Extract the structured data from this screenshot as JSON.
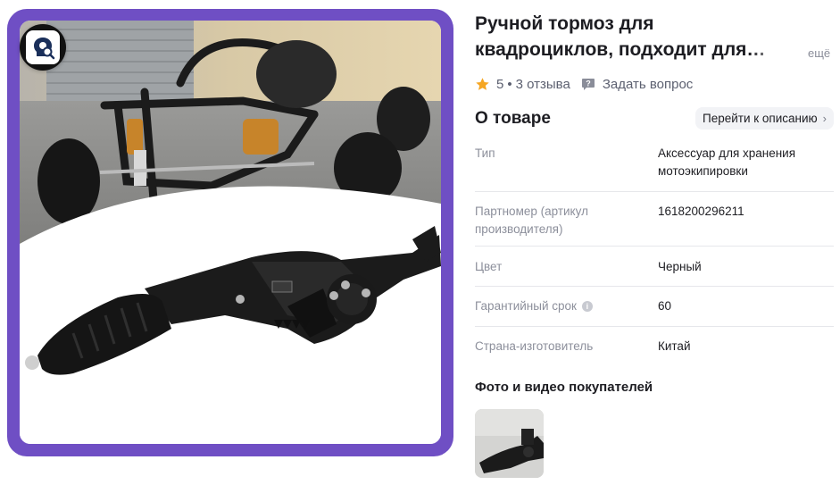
{
  "product": {
    "title": "Ручной тормоз для квадроциклов, подходит для мотоциклов",
    "more_label": "ещё"
  },
  "rating": {
    "score": "5",
    "separator": "•",
    "reviews": "3 отзыва",
    "ask_question": "Задать вопрос",
    "star_color": "#f5a623"
  },
  "about": {
    "title": "О товаре",
    "to_description": "Перейти к описанию"
  },
  "specs": [
    {
      "key": "Тип",
      "value": "Аксессуар для хранения мотоэкипировки"
    },
    {
      "key": "Партномер (артикул производителя)",
      "value": "1618200296211"
    },
    {
      "key": "Цвет",
      "value": "Черный"
    },
    {
      "key": "Гарантийный срок",
      "value": "60",
      "info": true
    },
    {
      "key": "Страна-изготовитель",
      "value": "Китай"
    }
  ],
  "ugc": {
    "title": "Фото и видео покупателей"
  },
  "colors": {
    "frame": "#6f4fc4",
    "text": "#1d1d22",
    "muted": "#8c8f9b"
  },
  "icons": {
    "search_badge": "image-search-icon",
    "star": "star-icon",
    "ask": "chat-question-icon",
    "chevron": "chevron-right-icon"
  }
}
